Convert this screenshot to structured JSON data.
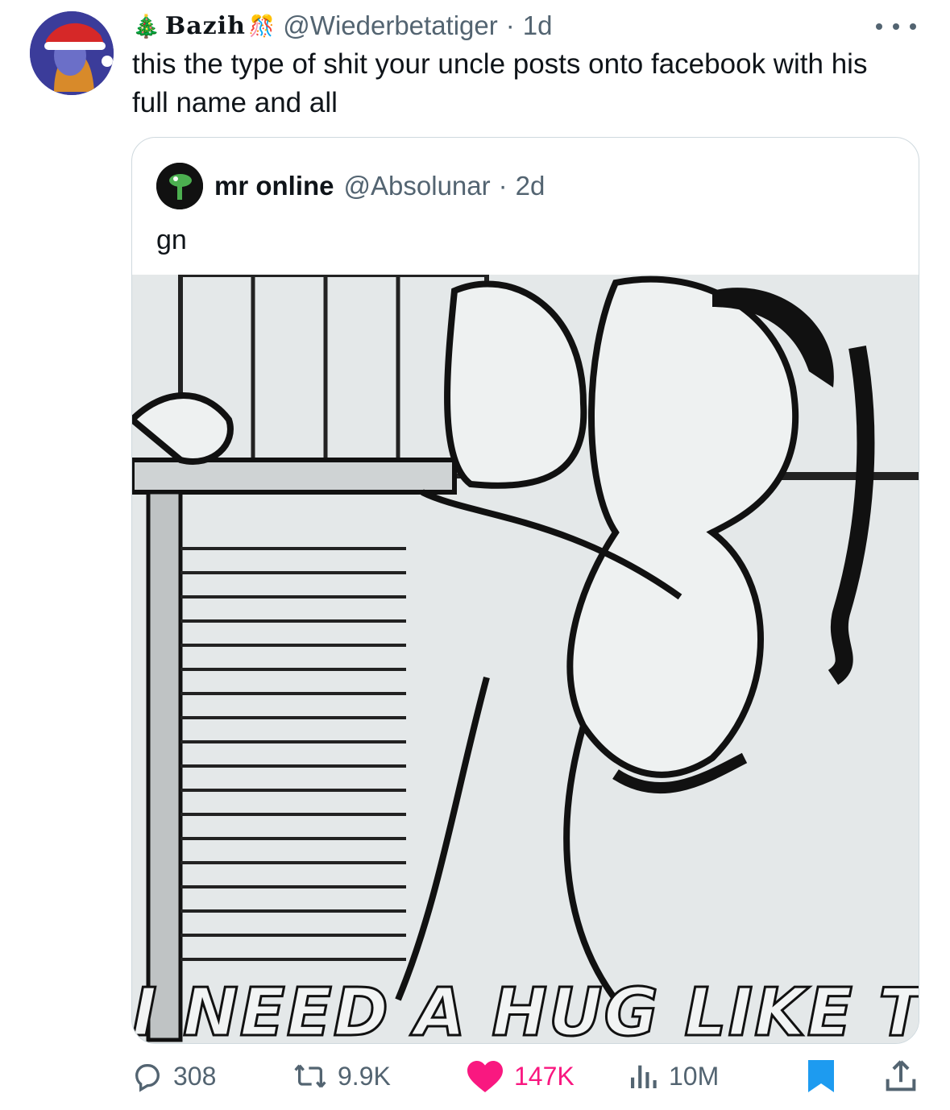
{
  "tweet": {
    "display_name": "Bazih",
    "handle": "@Wiederbetatiger",
    "separator": "·",
    "time": "1d",
    "text": "this the type of shit your uncle posts onto facebook with his full name and all"
  },
  "quoted": {
    "display_name": "mr online",
    "handle": "@Absolunar",
    "separator": "·",
    "time": "2d",
    "text": "gn",
    "image_caption": "I NEED A HUG LIKE THIS!"
  },
  "actions": {
    "replies": "308",
    "retweets": "9.9K",
    "likes": "147K",
    "views": "10M"
  },
  "colors": {
    "like": "#f91880",
    "muted": "#536471",
    "bookmark": "#1d9bf0"
  },
  "icons": [
    "reply-icon",
    "retweet-icon",
    "heart-icon",
    "views-icon",
    "bookmark-icon",
    "share-icon",
    "more-icon"
  ]
}
